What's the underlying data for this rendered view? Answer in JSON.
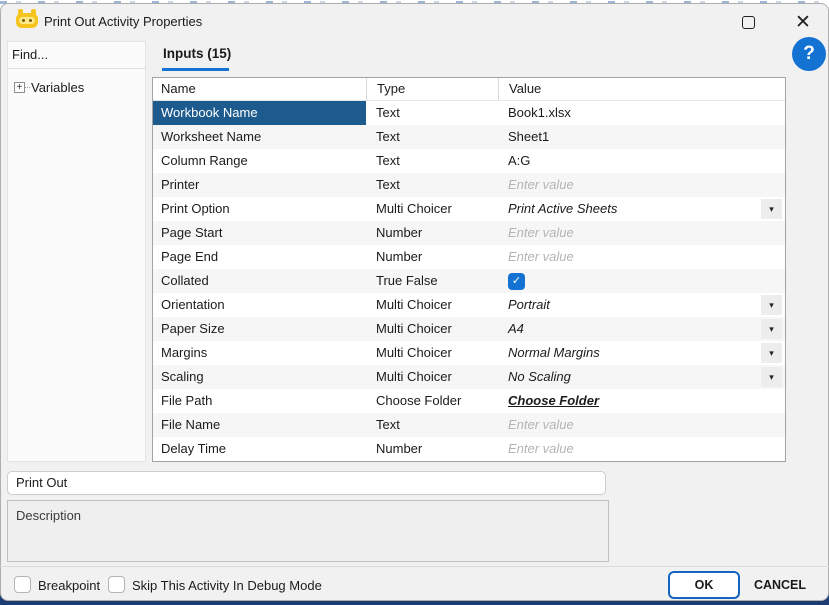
{
  "window": {
    "title": "Print Out Activity Properties",
    "controls": {
      "maximize": "maximize",
      "close": "close"
    }
  },
  "help": {
    "glyph": "?"
  },
  "sidebar": {
    "find_placeholder": "Find...",
    "items": [
      {
        "label": "Variables",
        "expander": "+"
      }
    ]
  },
  "tab": {
    "label": "Inputs (15)"
  },
  "table": {
    "columns": [
      "Name",
      "Type",
      "Value"
    ],
    "rows": [
      {
        "name": "Workbook Name",
        "type": "Text",
        "kind": "text",
        "value": "Book1.xlsx",
        "selected": true
      },
      {
        "name": "Worksheet Name",
        "type": "Text",
        "kind": "text",
        "value": "Sheet1"
      },
      {
        "name": "Column Range",
        "type": "Text",
        "kind": "text",
        "value": "A:G"
      },
      {
        "name": "Printer",
        "type": "Text",
        "kind": "text",
        "placeholder": "Enter value"
      },
      {
        "name": "Print Option",
        "type": "Multi Choicer",
        "kind": "choice",
        "value": "Print Active Sheets"
      },
      {
        "name": "Page Start",
        "type": "Number",
        "kind": "text",
        "placeholder": "Enter value"
      },
      {
        "name": "Page End",
        "type": "Number",
        "kind": "text",
        "placeholder": "Enter value"
      },
      {
        "name": "Collated",
        "type": "True False",
        "kind": "bool",
        "checked": true
      },
      {
        "name": "Orientation",
        "type": "Multi Choicer",
        "kind": "choice",
        "value": "Portrait"
      },
      {
        "name": "Paper Size",
        "type": "Multi Choicer",
        "kind": "choice",
        "value": "A4"
      },
      {
        "name": "Margins",
        "type": "Multi Choicer",
        "kind": "choice",
        "value": "Normal Margins"
      },
      {
        "name": "Scaling",
        "type": "Multi Choicer",
        "kind": "choice",
        "value": "No Scaling"
      },
      {
        "name": "File Path",
        "type": "Choose Folder",
        "kind": "link",
        "value": "Choose Folder"
      },
      {
        "name": "File Name",
        "type": "Text",
        "kind": "text",
        "placeholder": "Enter value"
      },
      {
        "name": "Delay Time",
        "type": "Number",
        "kind": "text",
        "placeholder": "Enter value"
      }
    ]
  },
  "name_field": {
    "value": "Print Out"
  },
  "description": {
    "placeholder": "Description"
  },
  "footer": {
    "breakpoint_label": "Breakpoint",
    "skip_label": "Skip This Activity In Debug Mode",
    "ok_label": "OK",
    "cancel_label": "CANCEL"
  },
  "colors": {
    "accent": "#1473d2",
    "selection": "#1d5b8e",
    "ok_border": "#1565c0",
    "bottom_strip": "#1e3c74",
    "placeholder_text": "#b4b4b4"
  }
}
